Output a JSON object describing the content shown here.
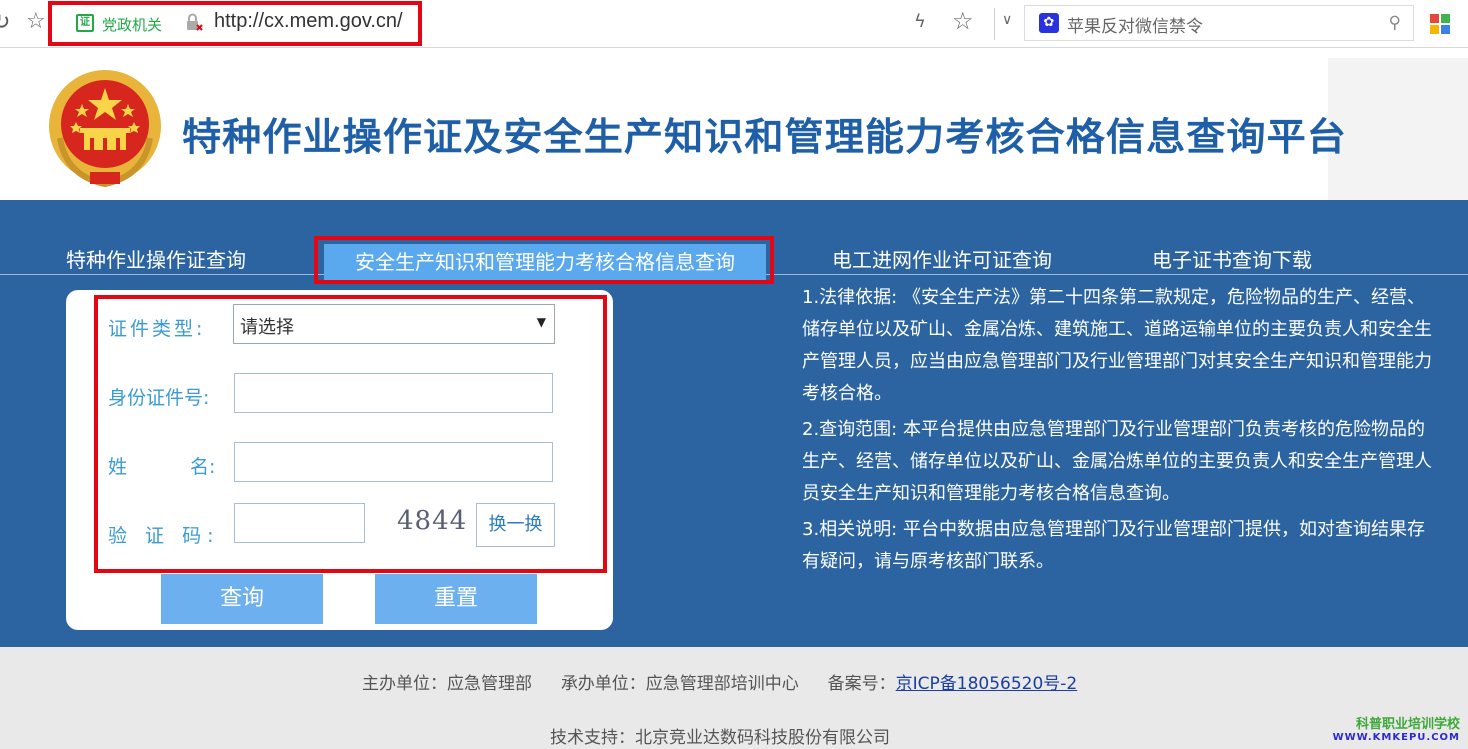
{
  "browser": {
    "cert_label": "党政机关",
    "url": "http://cx.mem.gov.cn/",
    "search_text": "苹果反对微信禁令"
  },
  "header": {
    "title": "特种作业操作证及安全生产知识和管理能力考核合格信息查询平台"
  },
  "nav": {
    "tabs": [
      {
        "label": "特种作业操作证查询"
      },
      {
        "label": "安全生产知识和管理能力考核合格信息查询"
      },
      {
        "label": "电工进网作业许可证查询"
      },
      {
        "label": "电子证书查询下载"
      }
    ]
  },
  "form": {
    "cert_type_label": "证件类型:",
    "cert_type_value": "请选择",
    "id_label": "身份证件号:",
    "id_value": "",
    "name_label_1": "姓",
    "name_label_2": "名:",
    "name_value": "",
    "captcha_label": "验 证 码:",
    "captcha_value": "",
    "captcha_text": "4844",
    "refresh_label": "换一换",
    "query_label": "查询",
    "reset_label": "重置"
  },
  "info": [
    "1.法律依据: 《安全生产法》第二十四条第二款规定，危险物品的生产、经营、储存单位以及矿山、金属冶炼、建筑施工、道路运输单位的主要负责人和安全生产管理人员，应当由应急管理部门及行业管理部门对其安全生产知识和管理能力考核合格。",
    "2.查询范围: 本平台提供由应急管理部门及行业管理部门负责考核的危险物品的生产、经营、储存单位以及矿山、金属冶炼单位的主要负责人和安全生产管理人员安全生产知识和管理能力考核合格信息查询。",
    "3.相关说明: 平台中数据由应急管理部门及行业管理部门提供，如对查询结果存有疑问，请与原考核部门联系。"
  ],
  "footer": {
    "sponsor": "主办单位：应急管理部",
    "organizer": "承办单位：应急管理部培训中心",
    "icp_label": "备案号：",
    "icp_link": "京ICP备18056520号-2",
    "tech_support": "技术支持：北京竞业达数码科技股份有限公司"
  },
  "watermark": {
    "line1": "科普职业培训学校",
    "line2": "WWW.KMKEPU.COM"
  },
  "colors": {
    "brand_blue": "#2b64a0",
    "title_blue": "#1f5fa8",
    "active_tab": "#5aa9ee",
    "highlight_red": "#e30613",
    "button_blue": "#6cb0ef"
  }
}
